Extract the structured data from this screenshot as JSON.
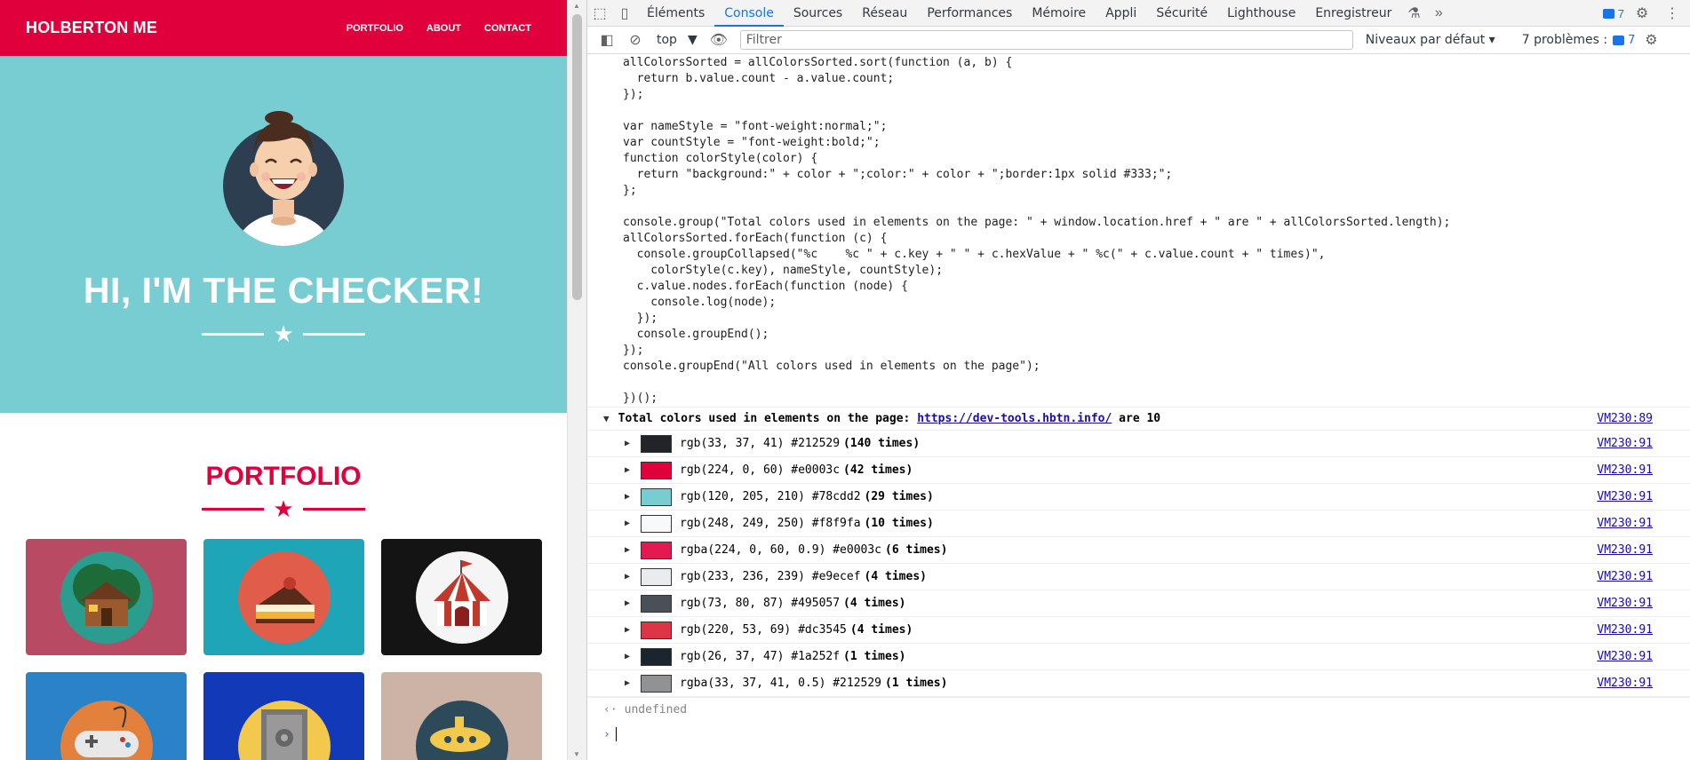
{
  "site": {
    "brand": "HOLBERTON ME",
    "nav": [
      "PORTFOLIO",
      "ABOUT",
      "CONTACT"
    ],
    "hero_title": "HI, I'M THE CHECKER!",
    "portfolio_title": "PORTFOLIO",
    "colors": {
      "primary": "#e0003c",
      "hero_bg": "#78cdd2",
      "dark": "#2c3e50"
    },
    "tiles": [
      {
        "name": "cabin",
        "bg": "#b84a64",
        "circle": "#2a9d8f",
        "icon": "cabin-icon"
      },
      {
        "name": "cake",
        "bg": "#1fa5b8",
        "circle": "#e05d4a",
        "icon": "cake-icon"
      },
      {
        "name": "circus",
        "bg": "#141414",
        "circle": "#f5f5f5",
        "icon": "circus-tent-icon"
      },
      {
        "name": "game",
        "bg": "#2a82c8",
        "circle": "#e3803c",
        "icon": "gamepad-icon"
      },
      {
        "name": "safe",
        "bg": "#1239b8",
        "circle": "#f2c94c",
        "icon": "safe-icon"
      },
      {
        "name": "submarine",
        "bg": "#cdb3a6",
        "circle": "#2c4a5a",
        "icon": "submarine-icon"
      }
    ]
  },
  "devtools": {
    "tabs": [
      "Éléments",
      "Console",
      "Sources",
      "Réseau",
      "Performances",
      "Mémoire",
      "Appli",
      "Sécurité",
      "Lighthouse",
      "Enregistreur"
    ],
    "active_tab": "Console",
    "issues_badge": "7",
    "context": "top",
    "filter_placeholder": "Filtrer",
    "levels": "Niveaux par défaut",
    "problems_label": "7 problèmes :",
    "problems_count": "7",
    "code_lines": [
      "allColorsSorted = allColorsSorted.sort(function (a, b) {",
      "  return b.value.count - a.value.count;",
      "});",
      "",
      "var nameStyle = \"font-weight:normal;\";",
      "var countStyle = \"font-weight:bold;\";",
      "function colorStyle(color) {",
      "  return \"background:\" + color + \";color:\" + color + \";border:1px solid #333;\";",
      "};",
      "",
      "console.group(\"Total colors used in elements on the page: \" + window.location.href + \" are \" + allColorsSorted.length);",
      "allColorsSorted.forEach(function (c) {",
      "  console.groupCollapsed(\"%c    %c \" + c.key + \" \" + c.hexValue + \" %c(\" + c.value.count + \" times)\",",
      "    colorStyle(c.key), nameStyle, countStyle);",
      "  c.value.nodes.forEach(function (node) {",
      "    console.log(node);",
      "  });",
      "  console.groupEnd();",
      "});",
      "console.groupEnd(\"All colors used in elements on the page\");",
      "",
      "})();"
    ],
    "group_prefix": "Total colors used in elements on the page:",
    "group_url": "https://dev-tools.hbtn.info/",
    "group_suffix": "are 10",
    "group_src": "VM230:89",
    "colors": [
      {
        "swatch": "#212529",
        "label": "rgb(33, 37, 41) #212529",
        "count": "(140 times)",
        "src": "VM230:91"
      },
      {
        "swatch": "#e0003c",
        "label": "rgb(224, 0, 60) #e0003c",
        "count": "(42 times)",
        "src": "VM230:91"
      },
      {
        "swatch": "#78cdd2",
        "label": "rgb(120, 205, 210) #78cdd2",
        "count": "(29 times)",
        "src": "VM230:91"
      },
      {
        "swatch": "#f8f9fa",
        "label": "rgb(248, 249, 250) #f8f9fa",
        "count": "(10 times)",
        "src": "VM230:91"
      },
      {
        "swatch": "#e31a50",
        "label": "rgba(224, 0, 60, 0.9) #e0003c",
        "count": "(6 times)",
        "src": "VM230:91"
      },
      {
        "swatch": "#e9ecef",
        "label": "rgb(233, 236, 239) #e9ecef",
        "count": "(4 times)",
        "src": "VM230:91"
      },
      {
        "swatch": "#495057",
        "label": "rgb(73, 80, 87) #495057",
        "count": "(4 times)",
        "src": "VM230:91"
      },
      {
        "swatch": "#dc3545",
        "label": "rgb(220, 53, 69) #dc3545",
        "count": "(4 times)",
        "src": "VM230:91"
      },
      {
        "swatch": "#1a252f",
        "label": "rgb(26, 37, 47) #1a252f",
        "count": "(1 times)",
        "src": "VM230:91"
      },
      {
        "swatch": "#909294",
        "label": "rgba(33, 37, 41, 0.5) #212529",
        "count": "(1 times)",
        "src": "VM230:91"
      }
    ],
    "result": "undefined"
  }
}
